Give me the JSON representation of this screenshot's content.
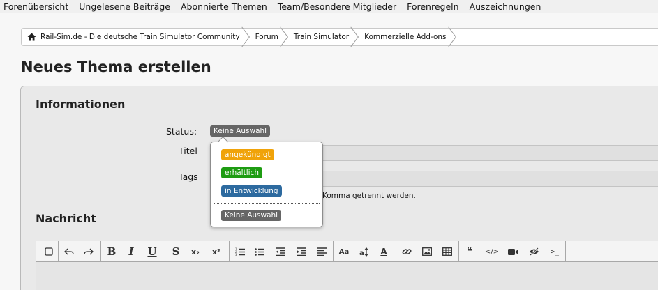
{
  "nav": {
    "items": [
      "Forenübersicht",
      "Ungelesene Beiträge",
      "Abonnierte Themen",
      "Team/Besondere Mitglieder",
      "Forenregeln",
      "Auszeichnungen"
    ]
  },
  "breadcrumb": {
    "items": [
      "Rail-Sim.de - Die deutsche Train Simulator Community",
      "Forum",
      "Train Simulator",
      "Kommerzielle Add-ons"
    ]
  },
  "page": {
    "title": "Neues Thema erstellen"
  },
  "informationen": {
    "heading": "Informationen",
    "status_label": "Status:",
    "status_value": "Keine Auswahl",
    "titel_label": "Titel",
    "tags_label": "Tags",
    "tags_hint": "Komma getrennt werden."
  },
  "status_menu": {
    "options": [
      {
        "label": "angekündigt",
        "color": "#f0a30a"
      },
      {
        "label": "erhältlich",
        "color": "#1e9c12"
      },
      {
        "label": "in Entwicklung",
        "color": "#2d6a9f"
      },
      {
        "label": "Keine Auswahl",
        "color": "#666666"
      }
    ]
  },
  "nachricht": {
    "heading": "Nachricht",
    "toolbar": {
      "bold": "B",
      "italic": "I",
      "underline": "U",
      "strike": "S",
      "subscript": "x₂",
      "superscript": "x²",
      "font_size": "Aa",
      "font_color": "A",
      "quote": "❝",
      "code": "</>",
      "inline_code": ">_"
    }
  }
}
